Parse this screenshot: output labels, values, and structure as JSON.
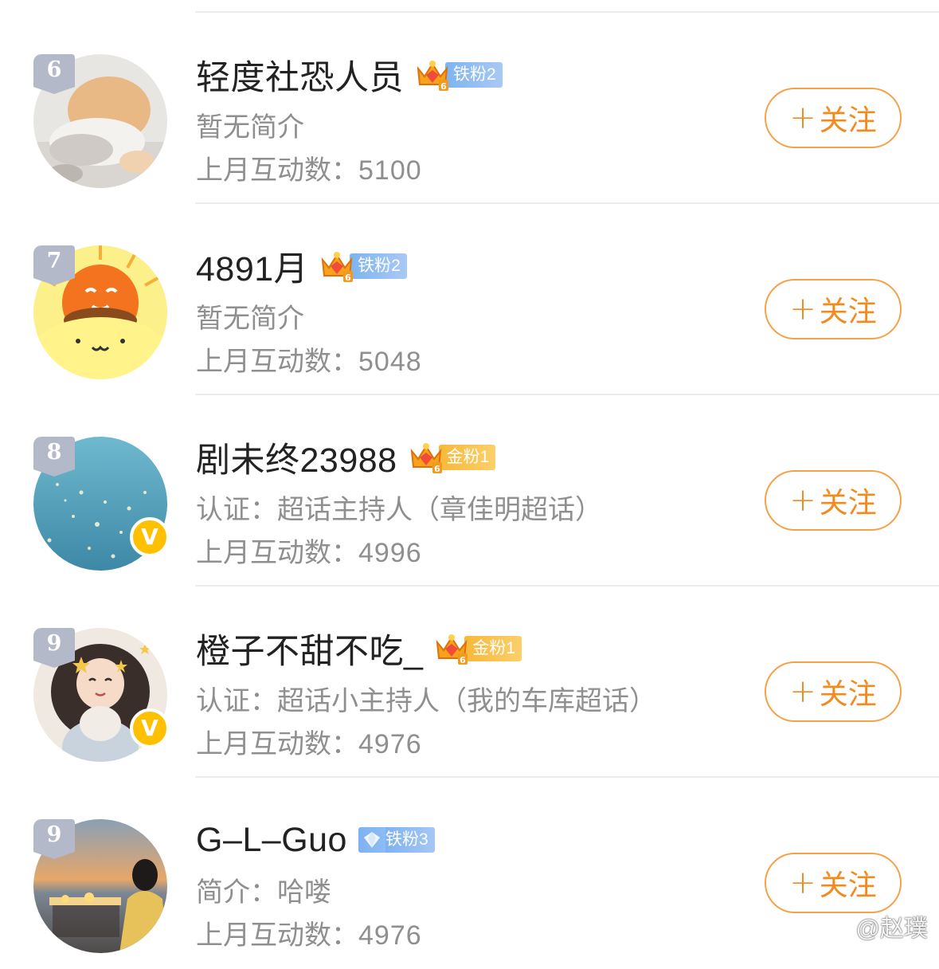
{
  "users": [
    {
      "rank": "6",
      "name": "轻度社恐人员",
      "fan_badge": {
        "type": "iron",
        "label": "铁粉2"
      },
      "bio": "暂无简介",
      "interact_label": "上月互动数：",
      "interact_value": "5100",
      "verified": false,
      "follow_label": "关注",
      "avatar_icon": "dog-avatar"
    },
    {
      "rank": "7",
      "name": "4891月",
      "fan_badge": {
        "type": "iron",
        "label": "铁粉2"
      },
      "bio": "暂无简介",
      "interact_label": "上月互动数：",
      "interact_value": "5048",
      "verified": false,
      "follow_label": "关注",
      "avatar_icon": "cartoon-sun-avatar"
    },
    {
      "rank": "8",
      "name": "剧未终23988",
      "fan_badge": {
        "type": "gold",
        "label": "金粉1"
      },
      "bio": "认证：超话主持人（章佳明超话）",
      "interact_label": "上月互动数：",
      "interact_value": "4996",
      "verified": true,
      "follow_label": "关注",
      "avatar_icon": "sea-avatar"
    },
    {
      "rank": "9",
      "name": "橙子不甜不吃_",
      "fan_badge": {
        "type": "gold",
        "label": "金粉1"
      },
      "bio": "认证：超话小主持人（我的车库超话）",
      "interact_label": "上月互动数：",
      "interact_value": "4976",
      "verified": true,
      "follow_label": "关注",
      "avatar_icon": "girl-avatar"
    },
    {
      "rank": "9",
      "name": "G–L–Guo",
      "fan_badge": {
        "type": "diamond",
        "label": "铁粉3"
      },
      "bio": "简介：哈喽",
      "interact_label": "上月互动数：",
      "interact_value": "4976",
      "verified": false,
      "follow_label": "关注",
      "avatar_icon": "beach-avatar"
    }
  ],
  "verified_mark": "V",
  "follow_plus": "+",
  "watermark": "@赵璞",
  "colors": {
    "follow_accent": "#f28a1e",
    "iron_badge": "#7db4f0",
    "gold_badge": "#f6b83b",
    "rank_badge": "#b3b9c8",
    "verified": "#ffc000"
  }
}
